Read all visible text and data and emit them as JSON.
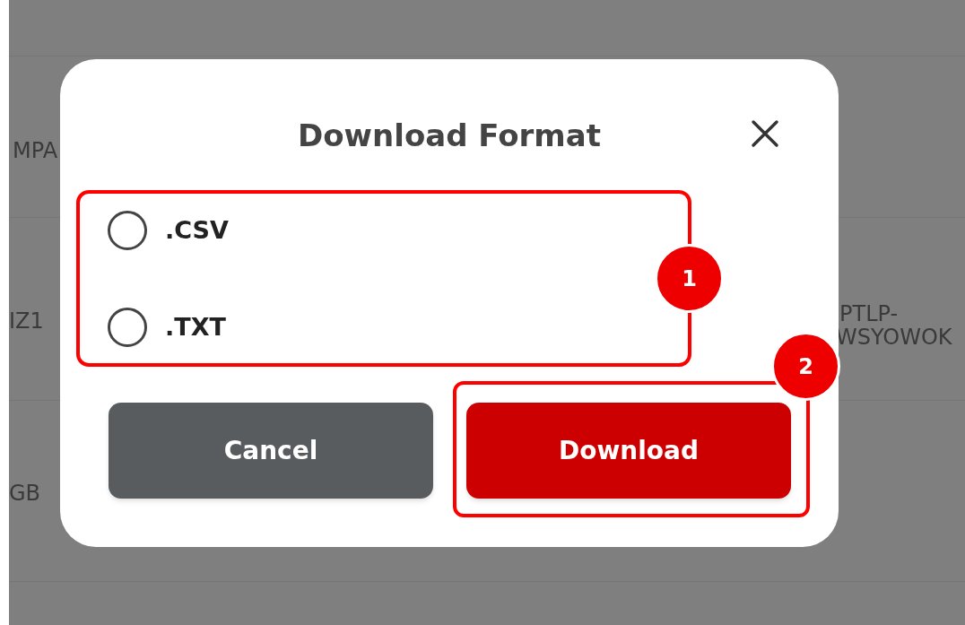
{
  "background_table": {
    "cells": [
      {
        "text": "MPA"
      },
      {
        "text": "IZ1"
      },
      {
        "text": "PTLP-"
      },
      {
        "text": "WSYOWOK"
      },
      {
        "text": "GB"
      }
    ]
  },
  "dialog": {
    "title": "Download Format",
    "options": [
      {
        "label": ".CSV",
        "selected": false
      },
      {
        "label": ".TXT",
        "selected": false
      }
    ],
    "buttons": [
      {
        "label": "Cancel",
        "kind": "secondary"
      },
      {
        "label": "Download",
        "kind": "primary"
      }
    ]
  },
  "annotations": [
    {
      "label": "1"
    },
    {
      "label": "2"
    }
  ]
}
